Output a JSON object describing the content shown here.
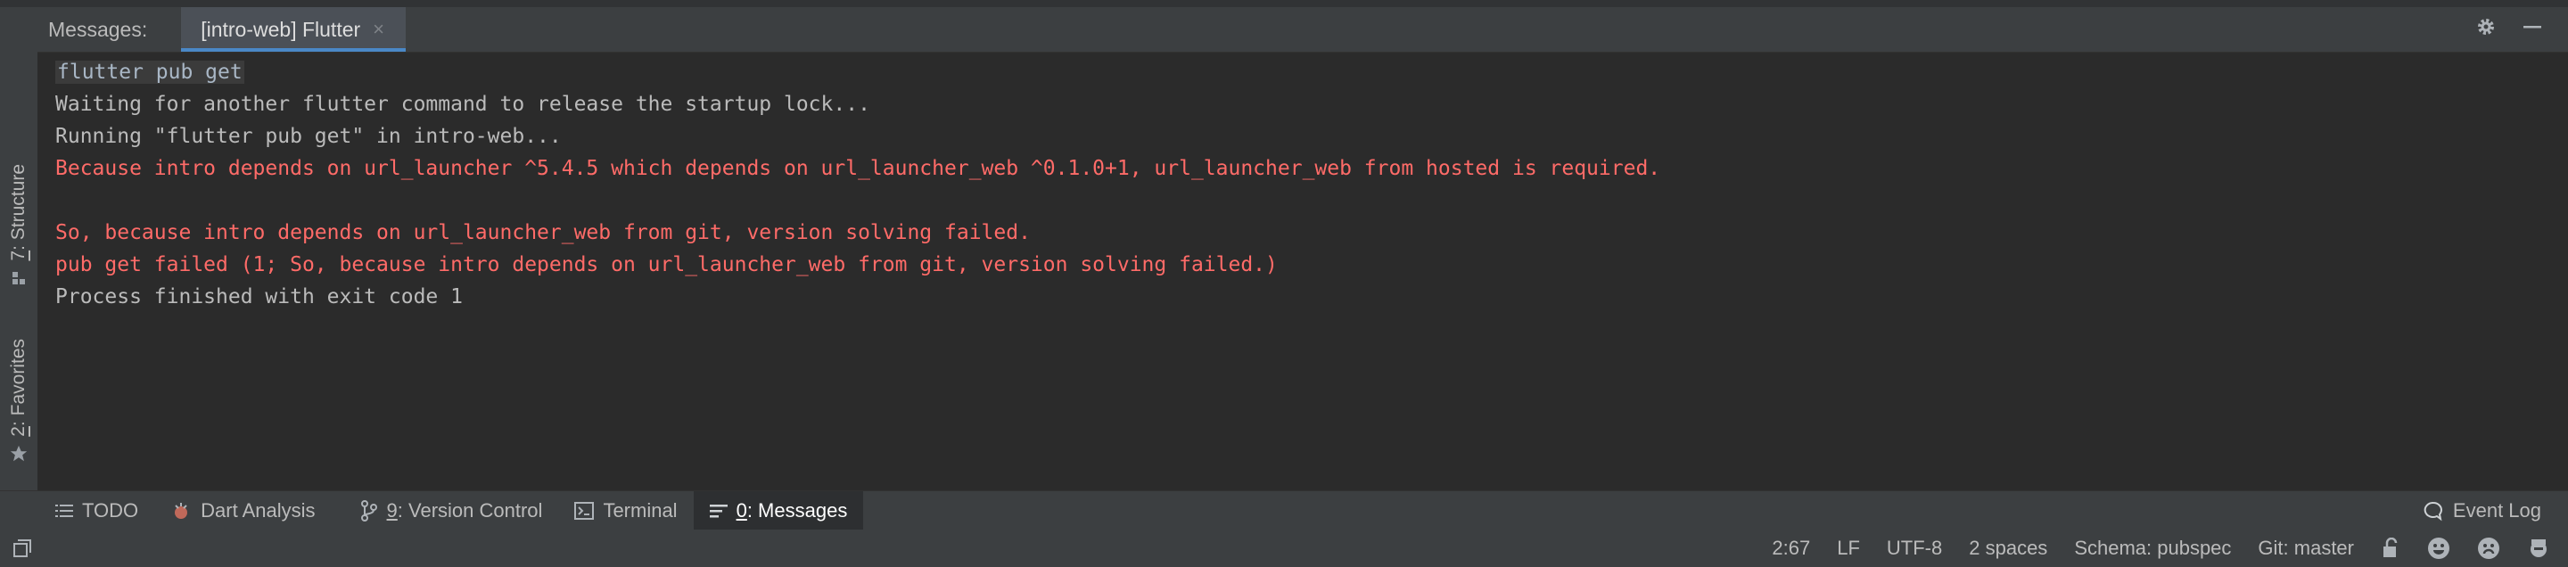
{
  "messages_panel": {
    "label": "Messages:",
    "active_tab": "[intro-web] Flutter",
    "close_glyph": "×"
  },
  "left_tools": {
    "structure": {
      "mnemonic": "7",
      "label": ": Structure"
    },
    "favorites": {
      "mnemonic": "2",
      "label": ": Favorites"
    }
  },
  "console": {
    "lines": [
      {
        "type": "cmd",
        "text": "flutter pub get"
      },
      {
        "type": "normal",
        "text": "Waiting for another flutter command to release the startup lock..."
      },
      {
        "type": "normal",
        "text": "Running \"flutter pub get\" in intro-web..."
      },
      {
        "type": "error",
        "text": "Because intro depends on url_launcher ^5.4.5 which depends on url_launcher_web ^0.1.0+1, url_launcher_web from hosted is required."
      },
      {
        "type": "error",
        "text": ""
      },
      {
        "type": "error",
        "text": "So, because intro depends on url_launcher_web from git, version solving failed."
      },
      {
        "type": "error",
        "text": "pub get failed (1; So, because intro depends on url_launcher_web from git, version solving failed.)"
      },
      {
        "type": "normal",
        "text": "Process finished with exit code 1"
      }
    ]
  },
  "tool_windows": {
    "todo": {
      "label": "TODO"
    },
    "dart_analysis": {
      "label": "Dart Analysis"
    },
    "version_control": {
      "mnemonic": "9",
      "label": ": Version Control"
    },
    "terminal": {
      "label": "Terminal"
    },
    "messages": {
      "mnemonic": "0",
      "label": ": Messages"
    },
    "event_log": {
      "label": "Event Log"
    }
  },
  "status_bar": {
    "position": "2:67",
    "line_separator": "LF",
    "encoding": "UTF-8",
    "indent": "2 spaces",
    "schema": "Schema: pubspec",
    "git_branch": "Git: master"
  },
  "colors": {
    "panel_bg": "#2b2b2b",
    "toolbar_bg": "#3c3f41",
    "error_text": "#ff6b68",
    "accent_tab_underline": "#4a88c7"
  },
  "icons": {
    "settings": "gear-icon",
    "minimize": "minimize-icon",
    "structure": "structure-icon",
    "favorites": "star-icon",
    "todo": "list-icon",
    "dart_analysis": "dart-analysis-icon",
    "version_control": "branch-icon",
    "terminal": "terminal-icon",
    "messages": "messages-icon",
    "event_log": "event-log-icon",
    "lock": "lock-icon",
    "happy": "smiley-icon",
    "sad": "sad-face-icon",
    "inspector": "hector-icon",
    "toggle_tool_windows": "tool-windows-icon"
  }
}
